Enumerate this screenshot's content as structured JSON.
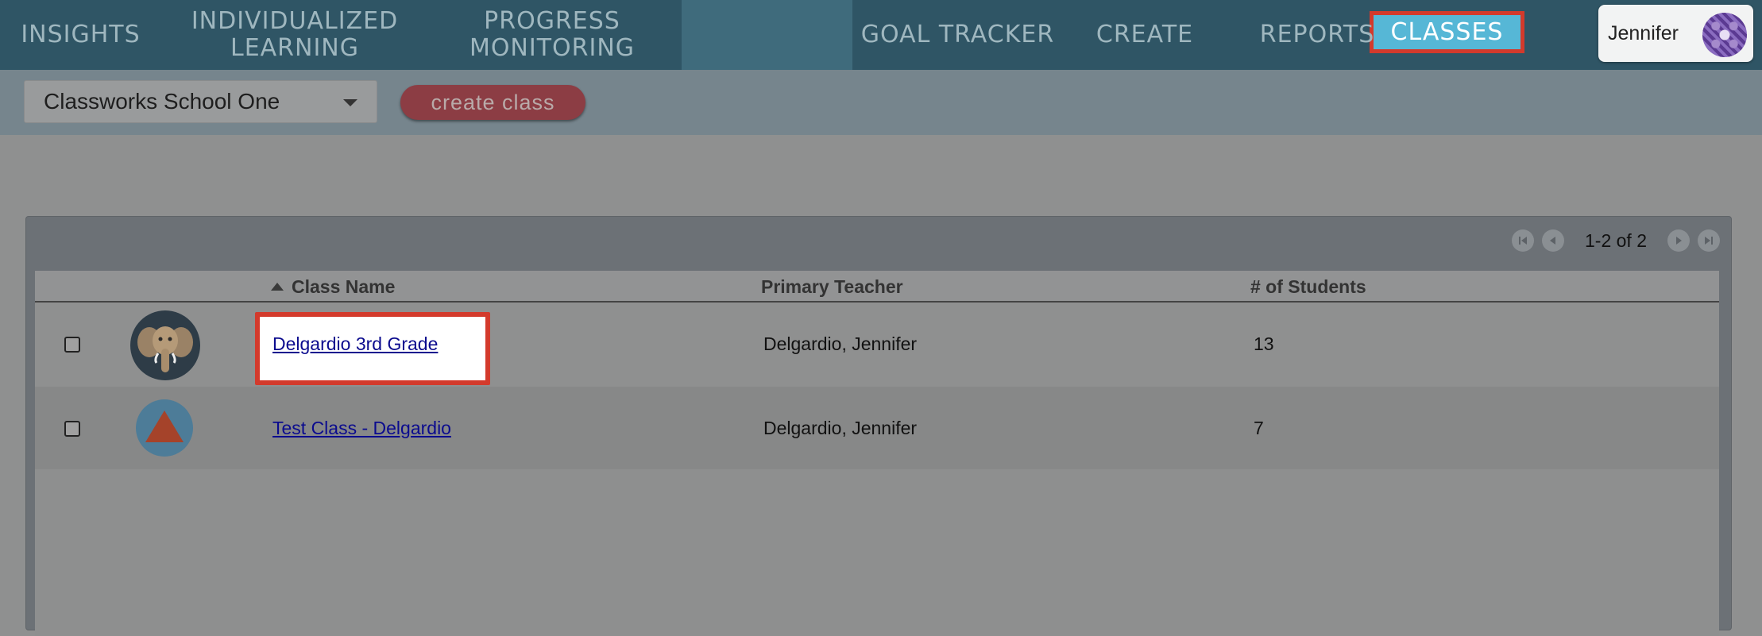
{
  "nav": {
    "items": [
      {
        "label": "INSIGHTS"
      },
      {
        "label": "INDIVIDUALIZED\nLEARNING"
      },
      {
        "label": "PROGRESS\nMONITORING"
      },
      {
        "label": "CLASSES"
      },
      {
        "label": "GOAL TRACKER"
      },
      {
        "label": "CREATE"
      },
      {
        "label": "REPORTS"
      }
    ],
    "user": {
      "name": "Jennifer",
      "avatar_icon": "purple-pattern-avatar"
    }
  },
  "toolbar": {
    "school_select": {
      "value": "Classworks School One"
    },
    "create_class_label": "create class"
  },
  "pager": {
    "text": "1-2 of 2"
  },
  "table": {
    "columns": [
      "Class Name",
      "Primary Teacher",
      "# of Students"
    ],
    "rows": [
      {
        "avatar_icon": "elephant-icon",
        "class_name": "Delgardio 3rd Grade",
        "teacher": "Delgardio, Jennifer",
        "students": "13"
      },
      {
        "avatar_icon": "triangle-icon",
        "class_name": "Test Class - Delgardio",
        "teacher": "Delgardio, Jennifer",
        "students": "7"
      }
    ]
  },
  "colors": {
    "nav_bg": "#2f5565",
    "active_tab": "#56b7d6",
    "highlight_border": "#d33a2c",
    "create_button": "#8c3d44"
  }
}
